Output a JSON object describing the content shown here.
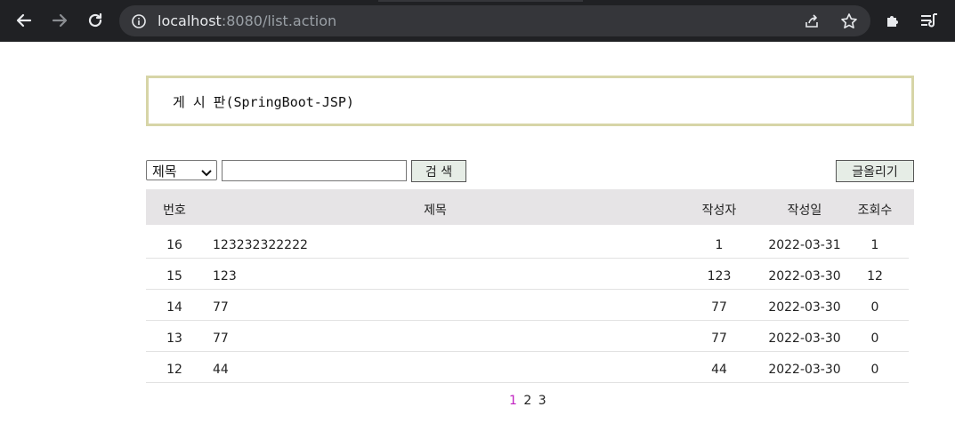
{
  "browser": {
    "url_host": "localhost",
    "url_rest": ":8080/list.action"
  },
  "page": {
    "title": "게 시 판(SpringBoot-JSP)"
  },
  "search": {
    "select_value": "제목",
    "input_value": "",
    "search_label": "검 색",
    "write_label": "글올리기"
  },
  "table": {
    "headers": {
      "num": "번호",
      "title": "제목",
      "writer": "작성자",
      "date": "작성일",
      "views": "조회수"
    },
    "rows": [
      {
        "num": "16",
        "title": "123232322222",
        "writer": "1",
        "date": "2022-03-31",
        "views": "1"
      },
      {
        "num": "15",
        "title": "123",
        "writer": "123",
        "date": "2022-03-30",
        "views": "12"
      },
      {
        "num": "14",
        "title": "77",
        "writer": "77",
        "date": "2022-03-30",
        "views": "0"
      },
      {
        "num": "13",
        "title": "77",
        "writer": "77",
        "date": "2022-03-30",
        "views": "0"
      },
      {
        "num": "12",
        "title": "44",
        "writer": "44",
        "date": "2022-03-30",
        "views": "0"
      }
    ]
  },
  "pagination": {
    "pages": [
      "1",
      "2",
      "3"
    ],
    "current": "1"
  },
  "colors": {
    "chrome_bg": "#202124",
    "title_border": "#d7d5a7",
    "header_bg": "#e6e4e6",
    "current_page": "#c020c0"
  },
  "icons": [
    "back-arrow-icon",
    "forward-arrow-icon",
    "reload-icon",
    "info-icon",
    "share-icon",
    "star-icon",
    "puzzle-extension-icon",
    "reading-list-icon"
  ]
}
